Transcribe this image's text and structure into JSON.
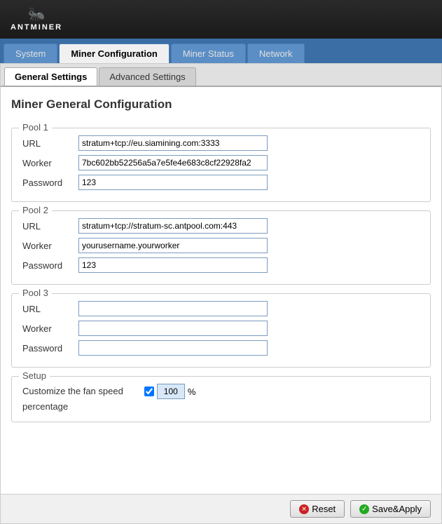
{
  "header": {
    "logo_text": "ANTMINER",
    "logo_icon": "♟"
  },
  "tabs": [
    {
      "id": "system",
      "label": "System",
      "active": false
    },
    {
      "id": "miner-config",
      "label": "Miner Configuration",
      "active": true
    },
    {
      "id": "miner-status",
      "label": "Miner Status",
      "active": false
    },
    {
      "id": "network",
      "label": "Network",
      "active": false
    }
  ],
  "sub_tabs": [
    {
      "id": "general-settings",
      "label": "General Settings",
      "active": true
    },
    {
      "id": "advanced-settings",
      "label": "Advanced Settings",
      "active": false
    }
  ],
  "page_title": "Miner General Configuration",
  "pool1": {
    "legend": "Pool 1",
    "url_label": "URL",
    "url_value": "stratum+tcp://eu.siamining.com:3333",
    "worker_label": "Worker",
    "worker_value": "7bc602bb52256a5a7e5fe4e683c8cf22928fa2",
    "password_label": "Password",
    "password_value": "123"
  },
  "pool2": {
    "legend": "Pool 2",
    "url_label": "URL",
    "url_value": "stratum+tcp://stratum-sc.antpool.com:443",
    "worker_label": "Worker",
    "worker_value": "yourusername.yourworker",
    "password_label": "Password",
    "password_value": "123"
  },
  "pool3": {
    "legend": "Pool 3",
    "url_label": "URL",
    "url_value": "",
    "worker_label": "Worker",
    "worker_value": "",
    "password_label": "Password",
    "password_value": ""
  },
  "setup": {
    "legend": "Setup",
    "fan_label_line1": "Customize the fan speed",
    "fan_label_line2": "percentage",
    "fan_value": "100",
    "fan_percent": "%"
  },
  "footer": {
    "reset_label": "Reset",
    "save_label": "Save&Apply"
  }
}
